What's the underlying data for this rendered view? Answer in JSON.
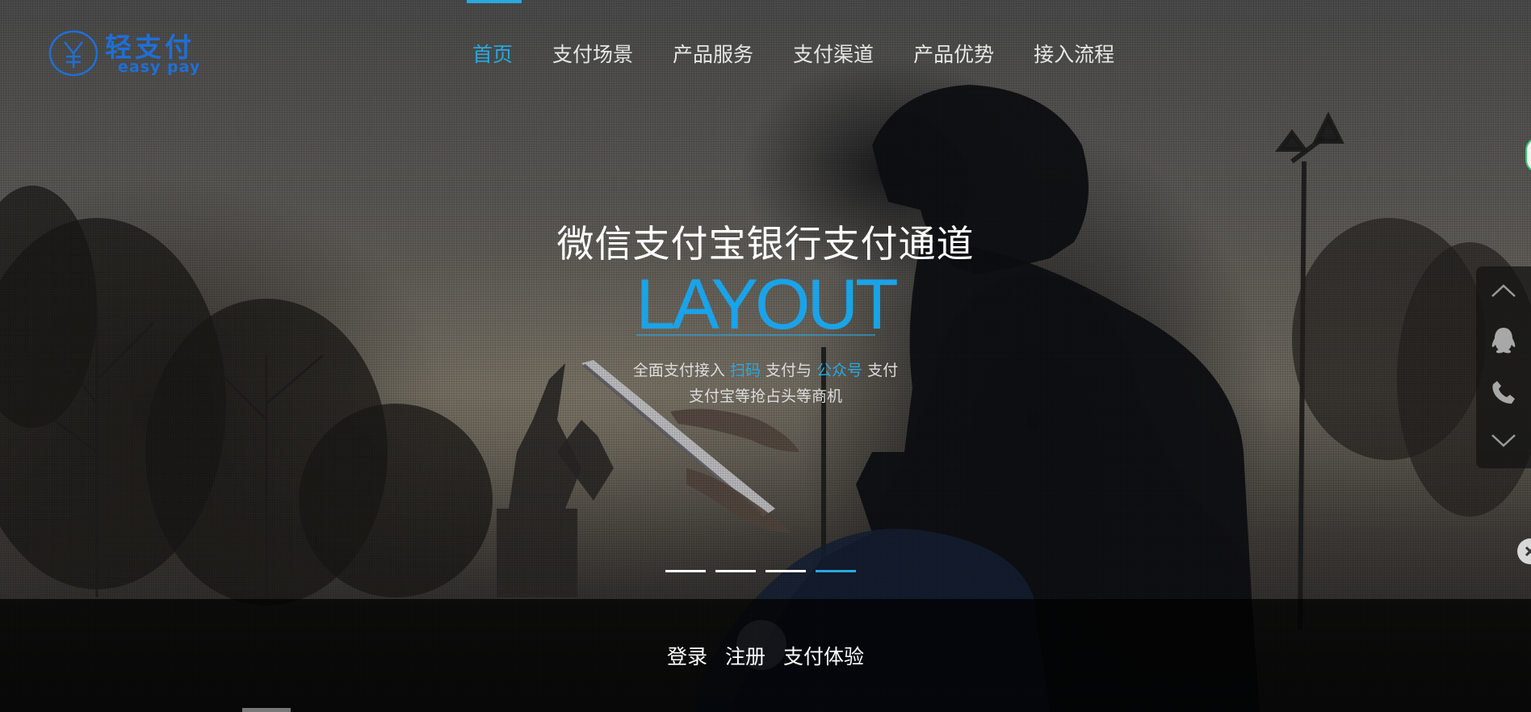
{
  "logo": {
    "brand_cn": "轻支付",
    "brand_en": "easy pay",
    "icon": "yen-circle-icon"
  },
  "nav": {
    "items": [
      {
        "label": "首页",
        "active": true
      },
      {
        "label": "支付场景",
        "active": false
      },
      {
        "label": "产品服务",
        "active": false
      },
      {
        "label": "支付渠道",
        "active": false
      },
      {
        "label": "产品优势",
        "active": false
      },
      {
        "label": "接入流程",
        "active": false
      }
    ]
  },
  "hero": {
    "title": "微信支付宝银行支付通道",
    "big": "LAYOUT",
    "sub_line1_a": "全面支付接入",
    "sub_line1_hl1": "扫码",
    "sub_line1_b": "支付与",
    "sub_line1_hl2": "公众号",
    "sub_line1_c": "支付",
    "sub_line2": "支付宝等抢占头等商机"
  },
  "slider": {
    "count": 4,
    "active_index": 3
  },
  "bottom": {
    "login": "登录",
    "register": "注册",
    "trial": "支付体验"
  },
  "side_panel": {
    "icons": [
      "chevron-up-icon",
      "qq-icon",
      "phone-icon",
      "chevron-down-icon"
    ]
  },
  "colors": {
    "accent": "#2ba8e0",
    "nav_text": "#e6e6e6",
    "bottom_bar": "rgba(0,0,0,0.72)"
  }
}
